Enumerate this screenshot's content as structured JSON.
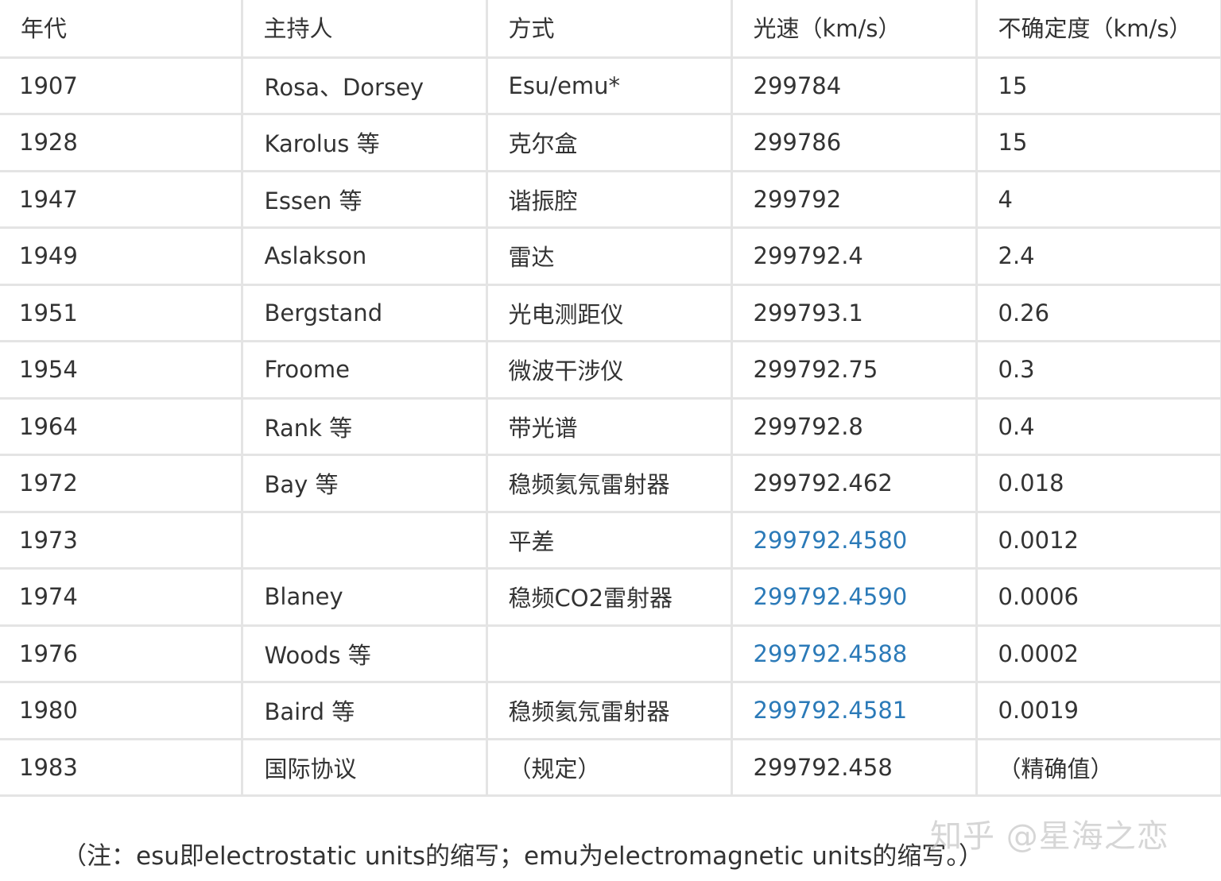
{
  "table": {
    "headers": [
      "年代",
      "主持人",
      "方式",
      "光速（km/s）",
      "不确定度（km/s）"
    ],
    "rows": [
      {
        "year": "1907",
        "host": "Rosa、Dorsey",
        "method": "Esu/emu*",
        "speed": "299784",
        "uncertainty": "15",
        "speed_link": false
      },
      {
        "year": "1928",
        "host": "Karolus 等",
        "method": "克尔盒",
        "speed": "299786",
        "uncertainty": "15",
        "speed_link": false
      },
      {
        "year": "1947",
        "host": "Essen 等",
        "method": "谐振腔",
        "speed": "299792",
        "uncertainty": "4",
        "speed_link": false
      },
      {
        "year": "1949",
        "host": "Aslakson",
        "method": "雷达",
        "speed": "299792.4",
        "uncertainty": "2.4",
        "speed_link": false
      },
      {
        "year": "1951",
        "host": "Bergstand",
        "method": "光电测距仪",
        "speed": "299793.1",
        "uncertainty": "0.26",
        "speed_link": false
      },
      {
        "year": "1954",
        "host": "Froome",
        "method": "微波干涉仪",
        "speed": "299792.75",
        "uncertainty": "0.3",
        "speed_link": false
      },
      {
        "year": "1964",
        "host": "Rank 等",
        "method": "带光谱",
        "speed": "299792.8",
        "uncertainty": "0.4",
        "speed_link": false
      },
      {
        "year": "1972",
        "host": "Bay 等",
        "method": "稳频氦氖雷射器",
        "speed": "299792.462",
        "uncertainty": "0.018",
        "speed_link": false
      },
      {
        "year": "1973",
        "host": "",
        "method": "平差",
        "speed": "299792.4580",
        "uncertainty": "0.0012",
        "speed_link": true
      },
      {
        "year": "1974",
        "host": "Blaney",
        "method": "稳频CO2雷射器",
        "speed": "299792.4590",
        "uncertainty": "0.0006",
        "speed_link": true
      },
      {
        "year": "1976",
        "host": "Woods 等",
        "method": "",
        "speed": "299792.4588",
        "uncertainty": "0.0002",
        "speed_link": true
      },
      {
        "year": "1980",
        "host": "Baird 等",
        "method": "稳频氦氖雷射器",
        "speed": "299792.4581",
        "uncertainty": "0.0019",
        "speed_link": true
      },
      {
        "year": "1983",
        "host": "国际协议",
        "method": "（规定）",
        "speed": "299792.458",
        "uncertainty": "（精确值）",
        "speed_link": false
      }
    ]
  },
  "footnote": "（注：esu即electrostatic units的缩写；emu为electromagnetic units的缩写。）",
  "watermark": "知乎 @星海之恋",
  "colors": {
    "link": "#2b7ab8",
    "border": "#e4e4e4",
    "text": "#333333"
  }
}
